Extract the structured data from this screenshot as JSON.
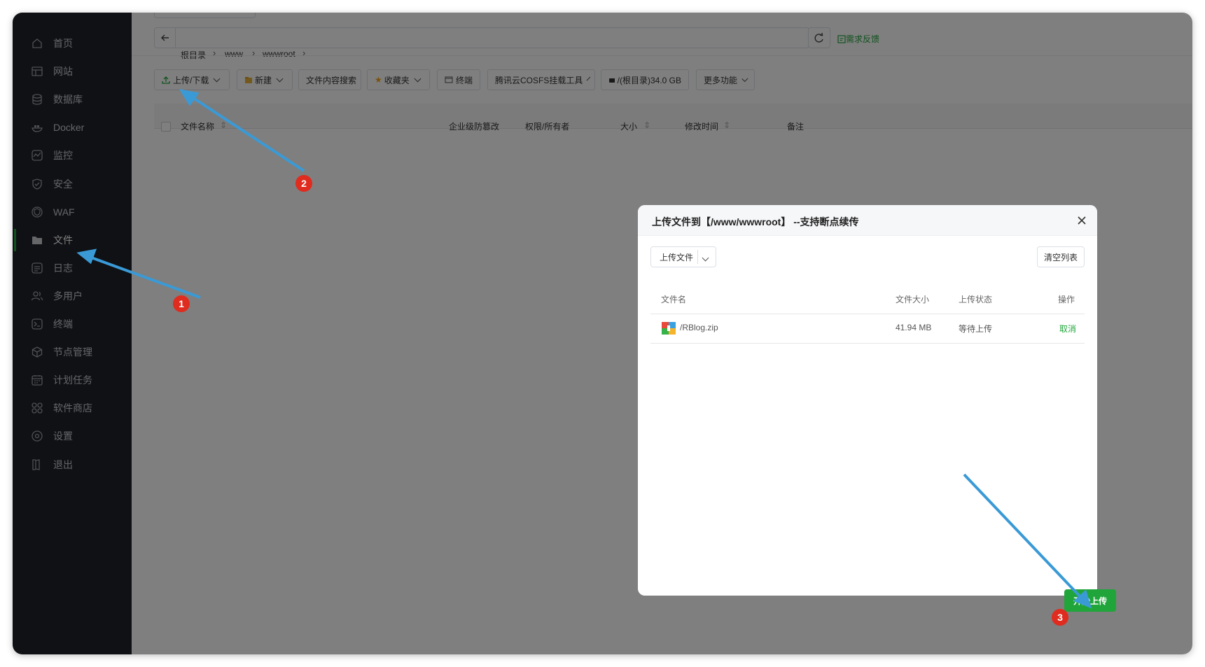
{
  "sidebar": {
    "items": [
      {
        "label": "首页",
        "icon": "home-icon"
      },
      {
        "label": "网站",
        "icon": "website-icon"
      },
      {
        "label": "数据库",
        "icon": "database-icon"
      },
      {
        "label": "Docker",
        "icon": "docker-icon"
      },
      {
        "label": "监控",
        "icon": "monitor-icon"
      },
      {
        "label": "安全",
        "icon": "shield-icon"
      },
      {
        "label": "WAF",
        "icon": "waf-icon"
      },
      {
        "label": "文件",
        "icon": "folder-icon",
        "active": true
      },
      {
        "label": "日志",
        "icon": "log-icon"
      },
      {
        "label": "多用户",
        "icon": "users-icon"
      },
      {
        "label": "终端",
        "icon": "terminal-icon"
      },
      {
        "label": "节点管理",
        "icon": "node-icon"
      },
      {
        "label": "计划任务",
        "icon": "calendar-icon"
      },
      {
        "label": "软件商店",
        "icon": "store-icon"
      },
      {
        "label": "设置",
        "icon": "gear-icon"
      },
      {
        "label": "退出",
        "icon": "logout-icon"
      }
    ]
  },
  "path": {
    "crumbs": [
      "根目录",
      "www",
      "wwwroot"
    ],
    "feedback": "需求反馈"
  },
  "toolbar": {
    "upload": "上传/下载",
    "new": "新建",
    "search": "文件内容搜索",
    "favorites": "收藏夹",
    "terminal": "终端",
    "cosfs": "腾讯云COSFS挂载工具",
    "disk": "/(根目录)34.0 GB",
    "more": "更多功能"
  },
  "table": {
    "headers": [
      "文件名称",
      "企业级防篡改",
      "权限/所有者",
      "大小",
      "修改时间",
      "备注"
    ]
  },
  "dialog": {
    "title": "上传文件到【/www/wwwroot】 --支持断点续传",
    "upload_file": "上传文件",
    "clear_list": "清空列表",
    "columns": [
      "文件名",
      "文件大小",
      "上传状态",
      "操作"
    ],
    "files": [
      {
        "name": "/RBlog.zip",
        "size": "41.94 MB",
        "status": "等待上传",
        "action": "取消"
      }
    ],
    "start_upload": "开始上传"
  },
  "annotations": [
    "1",
    "2",
    "3"
  ],
  "colors": {
    "accent": "#20a53a",
    "sidebar": "#20232a",
    "arrow": "#3a9ad6",
    "badge": "#e02b1f"
  }
}
